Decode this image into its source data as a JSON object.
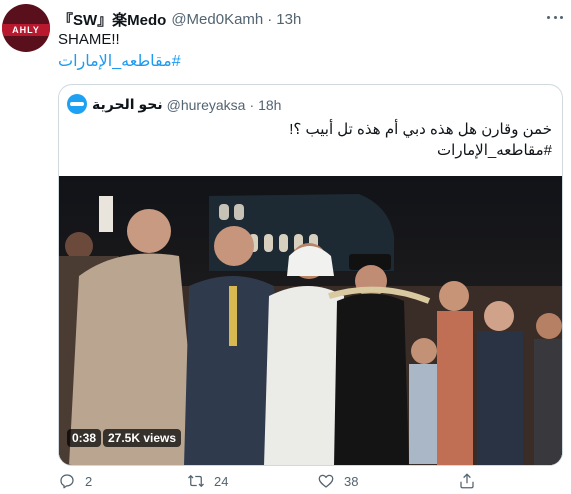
{
  "tweet": {
    "author_name": "『SW』楽Medo",
    "author_handle": "@Med0Kamh",
    "dot": "·",
    "time": "13h",
    "avatar_text": "AHLY",
    "text": "SHAME!!",
    "hashtag": "#مقاطعه_الإمارات"
  },
  "quoted": {
    "author_name": "نحو الحرية",
    "author_handle": "@hureyaksa",
    "dot": "·",
    "time": "18h",
    "text": "خمن وقارن هل هذه دبي أم هذه تل أبيب ؟!",
    "hashtag": "#مقاطعه_الإمارات",
    "video": {
      "duration": "0:38",
      "views": "27.5K views"
    }
  },
  "actions": {
    "reply_count": "2",
    "retweet_count": "24",
    "like_count": "38"
  },
  "colors": {
    "link": "#1d9bf0",
    "secondary_text": "#536471",
    "border": "#cfd9de"
  },
  "icons": [
    "more-icon",
    "reply-icon",
    "retweet-icon",
    "like-icon",
    "share-icon"
  ]
}
